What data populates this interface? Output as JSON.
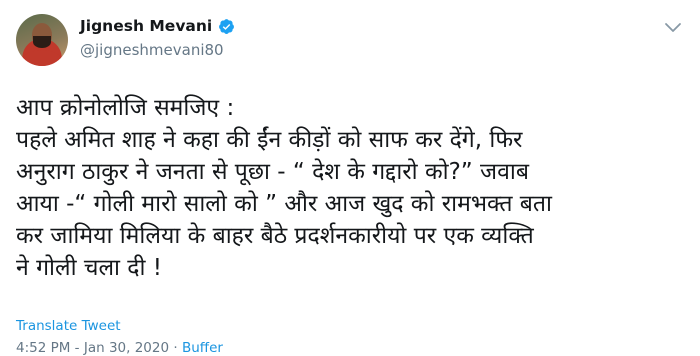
{
  "author": {
    "name": "Jignesh Mevani",
    "handle": "@jigneshmevani80"
  },
  "tweet": {
    "text": "आप क्रोनोलोजि समजिए :\nपहले अमित शाह ने कहा की ईंन कीड़ों को साफ कर देंगे, फिर\nअनुराग ठाकुर ने जनता से पूछा - “ देश के गद्दारो को?” जवाब\nआया -“ गोली मारो सालो को ” और आज खुद को रामभक्त बता\nकर जामिया मिलिया के बाहर बैठे प्रदर्शनकारीयो पर एक व्यक्ति\nने गोली चला दी !",
    "translate_label": "Translate Tweet",
    "timestamp": "4:52 PM - Jan 30, 2020",
    "separator": " · ",
    "source": "Buffer"
  },
  "icons": {
    "verified": "verified-badge-icon",
    "caret": "chevron-down-icon"
  },
  "colors": {
    "link": "#1b95e0",
    "verified": "#1da1f2",
    "muted": "#657786"
  }
}
